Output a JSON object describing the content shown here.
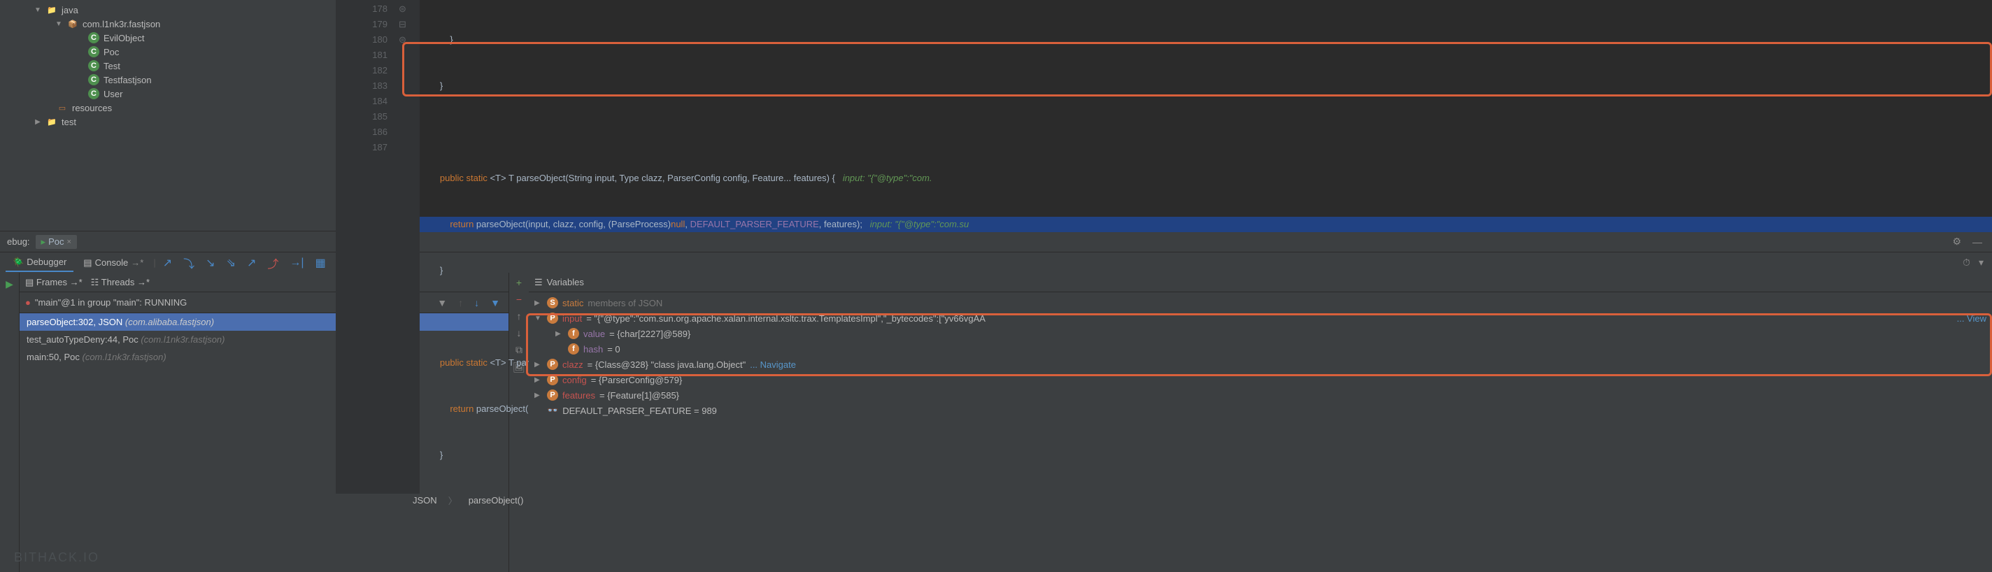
{
  "project": {
    "java": "java",
    "package": "com.l1nk3r.fastjson",
    "classes": [
      "EvilObject",
      "Poc",
      "Test",
      "Testfastjson",
      "User"
    ],
    "resources": "resources",
    "test": "test"
  },
  "code": {
    "lines": [
      "178",
      "179",
      "180",
      "181",
      "182",
      "183",
      "184",
      "185",
      "186",
      "187"
    ],
    "l178": "            }",
    "l179": "        }",
    "l181_sig": "        public static <T> T parseObject(String input, Type clazz, ParserConfig config, Feature... features) {",
    "l181_hint": "input: \"{\"@type\":\"com.",
    "l182_ret": "            return parseObject(input, clazz, config, (ParseProcess)null, DEFAULT_PARSER_FEATURE, features);",
    "l182_hint": "input: \"{\"@type\":\"com.su",
    "l183": "        }",
    "l185_sig": "        public static <T> T parseObject(String input, Type clazz, ParserConfig config, int featureValues, Feature... features) {",
    "l186_ret": "            return parseObject(input, clazz, config, (ParseProcess)null, featureValues, features);",
    "l187": "        }"
  },
  "breadcrumb": {
    "b1": "JSON",
    "b2": "parseObject()"
  },
  "debug": {
    "label": "ebug:",
    "tab": "Poc",
    "debugger_tab": "Debugger",
    "console_tab": "Console"
  },
  "frames": {
    "header_frames": "Frames",
    "header_threads": "Threads",
    "thread": "\"main\"@1 in group \"main\": RUNNING",
    "items": [
      {
        "label": "parseObject:302, JSON ",
        "pkg": "(com.alibaba.fastjson)"
      },
      {
        "label": "test_autoTypeDeny:44, Poc ",
        "pkg": "(com.l1nk3r.fastjson)"
      },
      {
        "label": "main:50, Poc ",
        "pkg": "(com.l1nk3r.fastjson)"
      }
    ]
  },
  "vars": {
    "header": "Variables",
    "static_label": "static",
    "static_rest": " members of JSON",
    "input_name": "input",
    "input_val": " = \"{\"@type\":\"com.sun.org.apache.xalan.internal.xsltc.trax.TemplatesImpl\",\"_bytecodes\":[\"yv66vgAA",
    "input_view": "... View",
    "value_name": "value",
    "value_val": " = {char[2227]@589}",
    "hash_name": "hash",
    "hash_val": " = 0",
    "clazz_name": "clazz",
    "clazz_val": " = {Class@328} \"class java.lang.Object\" ",
    "navigate": "... Navigate",
    "config_name": "config",
    "config_val": " = {ParserConfig@579}",
    "features_name": "features",
    "features_val": " = {Feature[1]@585}",
    "dpf_name": "DEFAULT_PARSER_FEATURE",
    "dpf_val": " = 989"
  },
  "watermark": "BITHACK.IO"
}
